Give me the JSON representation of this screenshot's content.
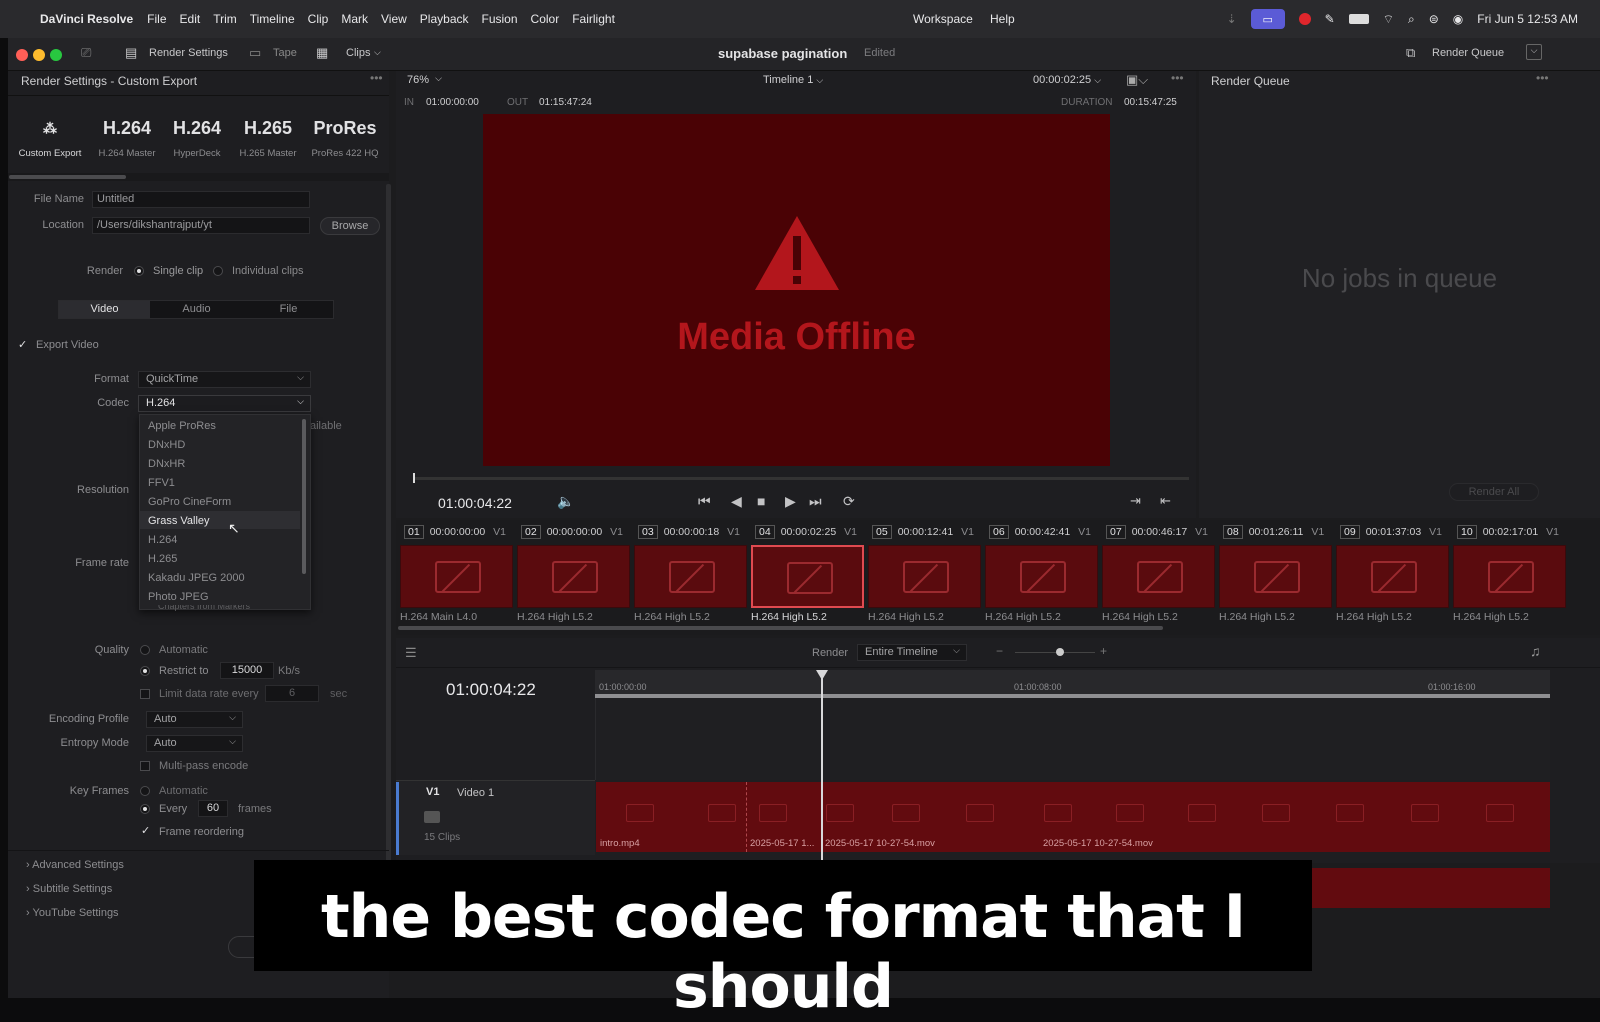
{
  "menubar": {
    "app_name": "DaVinci Resolve",
    "items": [
      "File",
      "Edit",
      "Trim",
      "Timeline",
      "Clip",
      "Mark",
      "View",
      "Playback",
      "Fusion",
      "Color",
      "Fairlight"
    ],
    "workspace": "Workspace",
    "help": "Help",
    "datetime": "Fri Jun 5  12:53 AM"
  },
  "toolbar": {
    "render_settings": "Render Settings",
    "tape": "Tape",
    "clips": "Clips",
    "project_title": "supabase pagination",
    "edited": "Edited",
    "render_queue": "Render Queue"
  },
  "render_settings": {
    "header": "Render Settings - Custom Export",
    "presets": [
      {
        "title": "",
        "sub": "Custom Export"
      },
      {
        "title": "H.264",
        "sub": "H.264 Master"
      },
      {
        "title": "H.264",
        "sub": "HyperDeck"
      },
      {
        "title": "H.265",
        "sub": "H.265 Master"
      },
      {
        "title": "ProRes",
        "sub": "ProRes 422 HQ"
      }
    ],
    "file_name_label": "File Name",
    "file_name": "Untitled",
    "location_label": "Location",
    "location": "/Users/dikshantrajput/yt",
    "browse": "Browse",
    "render_label": "Render",
    "single_clip": "Single clip",
    "individual_clips": "Individual clips",
    "tabs": [
      "Video",
      "Audio",
      "File"
    ],
    "export_video": "Export Video",
    "format_label": "Format",
    "format": "QuickTime",
    "codec_label": "Codec",
    "codec": "H.264",
    "available_fragment": "ailable",
    "resolution_label": "Resolution",
    "frame_rate_label": "Frame rate",
    "codec_options": [
      "Apple ProRes",
      "DNxHD",
      "DNxHR",
      "FFV1",
      "GoPro CineForm",
      "Grass Valley",
      "H.264",
      "H.265",
      "Kakadu JPEG 2000",
      "Photo JPEG"
    ],
    "hovered_option": "Grass Valley",
    "hidden_row": "Chapters from Markers",
    "quality_label": "Quality",
    "automatic": "Automatic",
    "restrict_to": "Restrict to",
    "bitrate": "15000",
    "bitrate_unit": "Kb/s",
    "limit_rate": "Limit data rate every",
    "limit_value": "6",
    "limit_unit": "sec",
    "encoding_profile_label": "Encoding Profile",
    "encoding_profile": "Auto",
    "entropy_mode_label": "Entropy Mode",
    "entropy_mode": "Auto",
    "multi_pass": "Multi-pass encode",
    "key_frames_label": "Key Frames",
    "key_auto": "Automatic",
    "every": "Every",
    "every_value": "60",
    "frames": "frames",
    "frame_reordering": "Frame reordering",
    "advanced": "Advanced Settings",
    "subtitle": "Subtitle Settings",
    "youtube": "YouTube Settings"
  },
  "viewer": {
    "zoom": "76%",
    "timeline": "Timeline 1",
    "timecode_top": "00:00:02:25",
    "in_label": "IN",
    "in_tc": "01:00:00:00",
    "out_label": "OUT",
    "out_tc": "01:15:47:24",
    "duration_label": "DURATION",
    "duration": "00:15:47:25",
    "offline_text": "Media Offline",
    "current_tc": "01:00:04:22"
  },
  "render_queue": {
    "header": "Render Queue",
    "empty": "No jobs in queue",
    "render_all": "Render All"
  },
  "clips": [
    {
      "num": "01",
      "tc": "00:00:00:00",
      "codec": "H.264 Main L4.0"
    },
    {
      "num": "02",
      "tc": "00:00:00:00",
      "codec": "H.264 High L5.2"
    },
    {
      "num": "03",
      "tc": "00:00:00:18",
      "codec": "H.264 High L5.2"
    },
    {
      "num": "04",
      "tc": "00:00:02:25",
      "codec": "H.264 High L5.2"
    },
    {
      "num": "05",
      "tc": "00:00:12:41",
      "codec": "H.264 High L5.2"
    },
    {
      "num": "06",
      "tc": "00:00:42:41",
      "codec": "H.264 High L5.2"
    },
    {
      "num": "07",
      "tc": "00:00:46:17",
      "codec": "H.264 High L5.2"
    },
    {
      "num": "08",
      "tc": "00:01:26:11",
      "codec": "H.264 High L5.2"
    },
    {
      "num": "09",
      "tc": "00:01:37:03",
      "codec": "H.264 High L5.2"
    },
    {
      "num": "10",
      "tc": "00:02:17:01",
      "codec": "H.264 High L5.2"
    }
  ],
  "clip_track": "V1",
  "timeline": {
    "render_label": "Render",
    "render_range": "Entire Timeline",
    "timecode": "01:00:04:22",
    "ruler": [
      "01:00:00:00",
      "01:00:08:00",
      "01:00:16:00"
    ],
    "track_label": "V1",
    "track_name": "Video 1",
    "clip_count": "15 Clips",
    "clip_names": [
      "intro.mp4",
      "2025-05-17 1...",
      "2025-05-17 10-27-54.mov",
      "2025-05-17 10-27-54.mov"
    ]
  },
  "caption": "the best codec format that I should"
}
